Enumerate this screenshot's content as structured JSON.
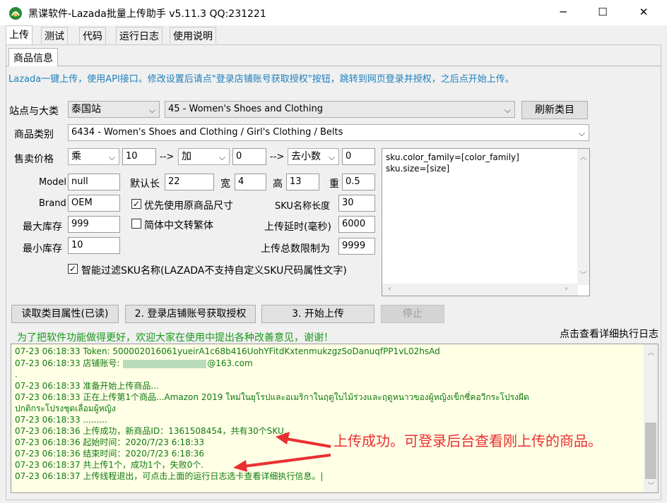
{
  "window": {
    "title": "黑谍软件-Lazada批量上传助手 v5.11.3 QQ:231221",
    "minimize": "─",
    "maximize": "☐",
    "close": "✕"
  },
  "menu": [
    "上传",
    "测试",
    "代码",
    "运行日志",
    "使用说明"
  ],
  "subtab": "商品信息",
  "notice": "Lazada一键上传，使用API接口。修改设置后请点\"登录店铺账号获取授权\"按钮，跳转到网页登录并授权，之后点开始上传。",
  "site": {
    "label": "站点与大类",
    "value": "泰国站",
    "category": "45 - Women's Shoes and Clothing",
    "refresh": "刷新类目"
  },
  "product_category": {
    "label": "商品类别",
    "value": "6434 - Women's Shoes and Clothing / Girl's Clothing / Belts"
  },
  "price": {
    "label": "售卖价格",
    "op1": "乘",
    "val1": "10",
    "arrow": "-->",
    "op2": "加",
    "val2": "0",
    "op3": "去小数",
    "val3": "0"
  },
  "fields": {
    "model_label": "Model",
    "model": "null",
    "length_label": "默认长",
    "length": "22",
    "width_label": "宽",
    "width": "4",
    "height_label": "高",
    "height": "13",
    "weight_label": "重",
    "weight": "0.5",
    "brand_label": "Brand",
    "brand": "OEM",
    "use_original_size": "优先使用原商品尺寸",
    "sku_name_len_label": "SKU名称长度",
    "sku_name_len": "30",
    "max_stock_label": "最大库存",
    "max_stock": "999",
    "simp_to_trad": "简体中文转繁体",
    "upload_delay_label": "上传延时(毫秒)",
    "upload_delay": "6000",
    "min_stock_label": "最小库存",
    "min_stock": "10",
    "upload_limit_label": "上传总数限制为",
    "upload_limit": "9999",
    "smart_filter": "智能过滤SKU名称(LAZADA不支持自定义SKU尺码属性文字)"
  },
  "sku_map": "sku.color_family=[color_family]\nsku.size=[size]",
  "buttons": {
    "read_attrs": "读取类目属性(已读)",
    "login": "2. 登录店铺账号获取授权",
    "start": "3. 开始上传",
    "stop": "停止"
  },
  "promo": "为了把软件功能做得更好，欢迎大家在使用中提出各种改善意见，谢谢！",
  "log_link": "点击查看详细执行日志",
  "log": [
    {
      "t": "07-23 06:18:33",
      "m": "Token: 500002016061yueirA1c68b416UohYFitdKxtenmukzgzSoDanuqfPP1vL02hsAd"
    },
    {
      "t": "07-23 06:18:33",
      "m": "店铺账号:",
      "suffix": "@163.com"
    },
    {
      "t": "",
      "m": "."
    },
    {
      "t": "07-23 06:18:33",
      "m": "准备开始上传商品..."
    },
    {
      "t": "07-23 06:18:33",
      "m": "正在上传第1个商品...Amazon 2019 ใหม่ในยุโรปและอเมริกาในฤดูใบไม้ร่วงและฤดูหนาวของผู้หญิงเข็กซี่คอวีกระโปรงผีด"
    },
    {
      "t": "",
      "m": "ปกติกระโปรงชุดเลื่อมผู้หญิง"
    },
    {
      "t": "07-23 06:18:33",
      "m": "........."
    },
    {
      "t": "07-23 06:18:36",
      "m": "上传成功，新商品ID：1361508454，共有30个SKU.."
    },
    {
      "t": "07-23 06:18:36",
      "m": "起始时间：2020/7/23 6:18:33"
    },
    {
      "t": "07-23 06:18:36",
      "m": "结束时间：2020/7/23 6:18:36"
    },
    {
      "t": "07-23 06:18:37",
      "m": "共上传1个，成功1个，失败0个."
    },
    {
      "t": "07-23 06:18:37",
      "m": "上传线程退出，可点击上面的运行日志选卡查看详细执行信息。|"
    }
  ],
  "annotation": "上传成功。可登录后台查看刚上传的商品。",
  "annotation_color": "#e83030",
  "icons": {
    "dropdown": "chevron-down-icon",
    "check": "✓"
  }
}
